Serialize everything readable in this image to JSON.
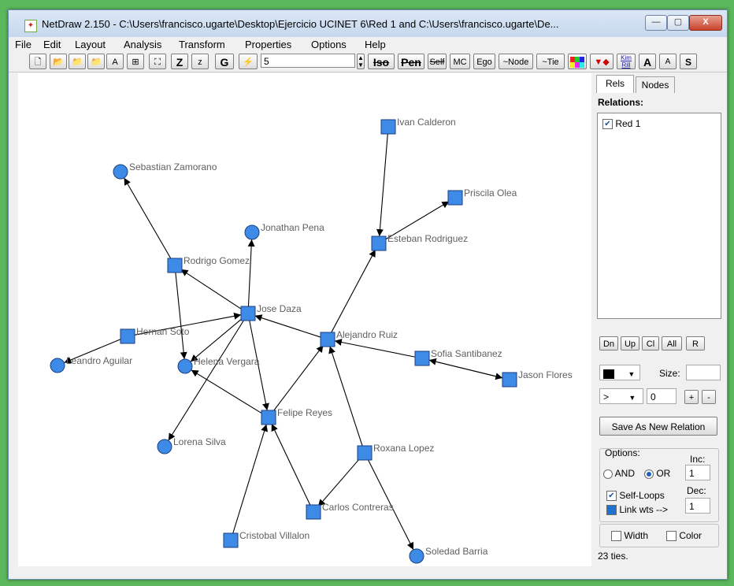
{
  "window": {
    "title": "NetDraw 2.150 - C:\\Users\\francisco.ugarte\\Desktop\\Ejercicio UCINET 6\\Red 1 and C:\\Users\\francisco.ugarte\\De...",
    "minimize_label": "—",
    "maximize_label": "▢",
    "close_label": "X"
  },
  "menu": [
    "File",
    "Edit",
    "Layout",
    "Analysis",
    "Transform",
    "Properties",
    "Options",
    "Help"
  ],
  "toolbar": {
    "z_upper": "Z",
    "z_lower": "z",
    "g": "G",
    "value_field": "5",
    "iso": "Iso",
    "pen": "Pen",
    "self": "Self",
    "mc": "MC",
    "ego": "Ego",
    "node": "~Node",
    "tie": "~Tie",
    "kim": "Kim Rill",
    "a_upper": "A",
    "a_lower": "A",
    "s": "S"
  },
  "graph": {
    "nodes": {
      "ivan": {
        "label": "Ivan Calderon",
        "shape": "square"
      },
      "priscila": {
        "label": "Priscila Olea",
        "shape": "square"
      },
      "esteban": {
        "label": "Esteban Rodriguez",
        "shape": "square"
      },
      "sebastian": {
        "label": "Sebastian Zamorano",
        "shape": "circle"
      },
      "jonathan": {
        "label": "Jonathan Pena",
        "shape": "circle"
      },
      "rodrigo": {
        "label": "Rodrigo Gomez",
        "shape": "square"
      },
      "jose": {
        "label": "Jose Daza",
        "shape": "square"
      },
      "hernan": {
        "label": "Hernan Soto",
        "shape": "square"
      },
      "leandro": {
        "label": "Leandro Aguilar",
        "shape": "circle"
      },
      "helena": {
        "label": "Helena Vergara",
        "shape": "circle"
      },
      "alejandro": {
        "label": "Alejandro Ruiz",
        "shape": "square"
      },
      "sofia": {
        "label": "Sofia Santibanez",
        "shape": "square"
      },
      "jason": {
        "label": "Jason Flores",
        "shape": "square"
      },
      "felipe": {
        "label": "Felipe Reyes",
        "shape": "square"
      },
      "lorena": {
        "label": "Lorena Silva",
        "shape": "circle"
      },
      "roxana": {
        "label": "Roxana Lopez",
        "shape": "square"
      },
      "carlos": {
        "label": "Carlos Contreras",
        "shape": "square"
      },
      "cristobal": {
        "label": "Cristobal Villalon",
        "shape": "square"
      },
      "soledad": {
        "label": "Soledad Barria",
        "shape": "circle"
      }
    },
    "edges": [
      [
        "ivan",
        "esteban"
      ],
      [
        "esteban",
        "priscila"
      ],
      [
        "alejandro",
        "esteban"
      ],
      [
        "rodrigo",
        "sebastian"
      ],
      [
        "rodrigo",
        "helena"
      ],
      [
        "jose",
        "rodrigo"
      ],
      [
        "jose",
        "jonathan"
      ],
      [
        "jose",
        "helena"
      ],
      [
        "jose",
        "lorena"
      ],
      [
        "jose",
        "felipe"
      ],
      [
        "hernan",
        "leandro"
      ],
      [
        "hernan",
        "jose"
      ],
      [
        "alejandro",
        "jose"
      ],
      [
        "sofia",
        "alejandro"
      ],
      [
        "sofia",
        "jason"
      ],
      [
        "jason",
        "sofia"
      ],
      [
        "felipe",
        "alejandro"
      ],
      [
        "felipe",
        "helena"
      ],
      [
        "roxana",
        "alejandro"
      ],
      [
        "roxana",
        "carlos"
      ],
      [
        "roxana",
        "soledad"
      ],
      [
        "carlos",
        "felipe"
      ],
      [
        "cristobal",
        "felipe"
      ]
    ],
    "node_color": "#3d8be6"
  },
  "side": {
    "tab_rels": "Rels",
    "tab_nodes": "Nodes",
    "relations_heading": "Relations:",
    "relation_item": "Red 1",
    "btn_dn": "Dn",
    "btn_up": "Up",
    "btn_cl": "Cl",
    "btn_all": "All",
    "btn_r": "R",
    "size_label": "Size:",
    "arrow_select": ">",
    "zero_value": "0",
    "plus": "+",
    "minus": "-",
    "save_button": "Save As New Relation",
    "options_legend": "Options:",
    "inc_label": "Inc:",
    "and_label": "AND",
    "or_label": "OR",
    "inc_value": "1",
    "dec_label": "Dec:",
    "self_loops": "Self-Loops",
    "dec_value": "1",
    "link_wts": "Link wts -->",
    "width_label": "Width",
    "color_label": "Color",
    "status": "23 ties."
  }
}
